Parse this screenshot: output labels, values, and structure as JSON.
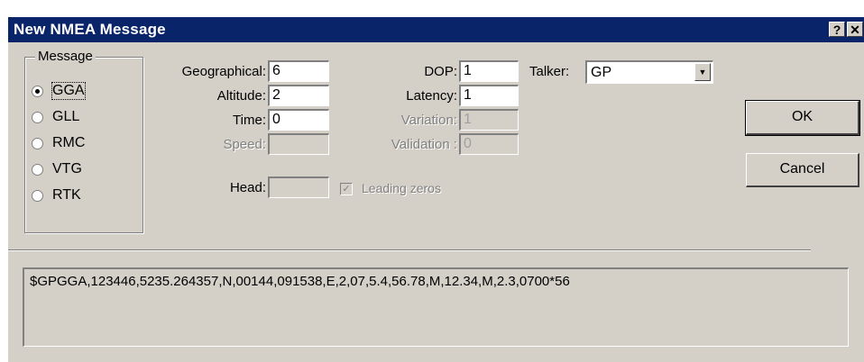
{
  "window": {
    "title": "New NMEA Message",
    "help_label": "?",
    "close_label": "✕"
  },
  "message_group": {
    "label": "Message",
    "options": [
      {
        "label": "GGA",
        "selected": true
      },
      {
        "label": "GLL",
        "selected": false
      },
      {
        "label": "RMC",
        "selected": false
      },
      {
        "label": "VTG",
        "selected": false
      },
      {
        "label": "RTK",
        "selected": false
      }
    ]
  },
  "fields": {
    "geographical": {
      "label": "Geographical:",
      "value": "6"
    },
    "altitude": {
      "label": "Altitude:",
      "value": "2"
    },
    "time": {
      "label": "Time:",
      "value": "0"
    },
    "speed": {
      "label": "Speed:",
      "value": ""
    },
    "head": {
      "label": "Head:",
      "value": ""
    },
    "dop": {
      "label": "DOP:",
      "value": "1"
    },
    "latency": {
      "label": "Latency:",
      "value": "1"
    },
    "variation": {
      "label": "Variation:",
      "value": "1"
    },
    "validation": {
      "label": "Validation :",
      "value": "0"
    }
  },
  "checkbox": {
    "label": "Leading zeros",
    "checked": true,
    "enabled": false
  },
  "talker": {
    "label": "Talker:",
    "value": "GP"
  },
  "buttons": {
    "ok": "OK",
    "cancel": "Cancel"
  },
  "output": {
    "text": "$GPGGA,123446,5235.264357,N,00144,091538,E,2,07,5.4,56.78,M,12.34,M,2.3,0700*56"
  },
  "colors": {
    "titlebar": "#0a246a",
    "face": "#d4d0c8",
    "disabled_text": "#808080"
  }
}
